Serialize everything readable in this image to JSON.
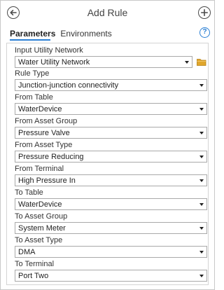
{
  "header": {
    "title": "Add Rule"
  },
  "tabs": [
    {
      "label": "Parameters"
    },
    {
      "label": "Environments"
    }
  ],
  "help": {
    "label": "?"
  },
  "fields": [
    {
      "label": "Input Utility Network",
      "value": "Water Utility Network"
    },
    {
      "label": "Rule Type",
      "value": "Junction-junction connectivity"
    },
    {
      "label": "From Table",
      "value": "WaterDevice"
    },
    {
      "label": "From Asset Group",
      "value": "Pressure Valve"
    },
    {
      "label": "From Asset Type",
      "value": "Pressure Reducing"
    },
    {
      "label": "From Terminal",
      "value": "High Pressure In"
    },
    {
      "label": "To Table",
      "value": "WaterDevice"
    },
    {
      "label": "To Asset Group",
      "value": "System Meter"
    },
    {
      "label": "To Asset Type",
      "value": "DMA"
    },
    {
      "label": "To Terminal",
      "value": "Port Two"
    }
  ],
  "colors": {
    "accent": "#2a7fd4",
    "folder": "#e0a62c"
  },
  "icons": {
    "back": "back-arrow-icon",
    "add": "plus-icon",
    "help": "help-icon",
    "browse": "folder-icon",
    "caret": "chevron-down-icon"
  }
}
